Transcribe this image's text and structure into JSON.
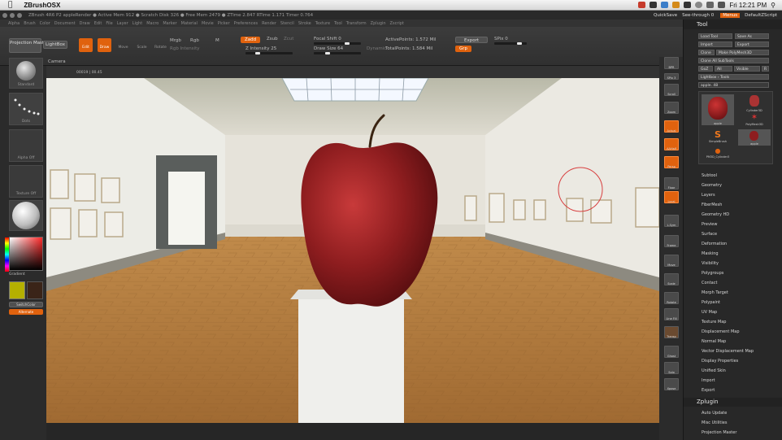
{
  "mac_menubar": {
    "app_name": "ZBrushOSX",
    "clock": "Fri 12:21 PM"
  },
  "title_bar": {
    "info": "ZBrush 4R6 P2    appleRender  ● Active Mem 912 ● Scratch Disk 326 ● Free Mem 2479 ● ZTime 2.847 RTime 1.171 Timer 0.764",
    "quicksave": "QuickSave",
    "seethrough": "See-through  0",
    "menus_label": "Menus",
    "script": "DefaultZScript"
  },
  "menu_row": [
    "Alpha",
    "Brush",
    "Color",
    "Document",
    "Draw",
    "Edit",
    "File",
    "Layer",
    "Light",
    "Macro",
    "Marker",
    "Material",
    "Movie",
    "Picker",
    "Preferences",
    "Render",
    "Stencil",
    "Stroke",
    "Texture",
    "Tool",
    "Transform",
    "Zplugin",
    "Zscript"
  ],
  "shelf": {
    "projection_master": "Projection Master",
    "lightbox": "LightBox",
    "edit": "Edit",
    "draw": "Draw",
    "move": "Move",
    "scale": "Scale",
    "rotate": "Rotate",
    "mrgb": "Mrgb",
    "rgb": "Rgb",
    "m": "M",
    "zadd": "Zadd",
    "zsub": "Zsub",
    "zcut": "Zcut",
    "rgb_intensity": "Rgb Intensity",
    "z_intensity": "Z Intensity 25",
    "focal_shift": "Focal Shift 0",
    "draw_size": "Draw Size 64",
    "dynamic": "Dynamic",
    "active_points": "ActivePoints: 1.572 Mil",
    "total_points": "TotalPoints: 1.584 Mil",
    "export": "Export",
    "spix": "SPix 0",
    "grp": "Grp"
  },
  "camera": {
    "label": "Camera",
    "value": "00019 | 00.45"
  },
  "left_tray": {
    "standard": "Standard",
    "dots": "Dots",
    "alpha_off": "Alpha Off",
    "texture_off": "Texture Off",
    "material": "SkinShade4",
    "gradient": "Gradient",
    "switch_color": "SwitchColor",
    "alternate": "Alternate",
    "colors": {
      "primary": "#b5b000",
      "secondary": "#3a2418"
    }
  },
  "right_tray": [
    "BPR",
    "SPix 3",
    "Scroll",
    "Zoom",
    "Actual",
    "AAHalf",
    "Persp",
    "Floor",
    "Local",
    "L.Sym",
    "Frame",
    "Move",
    "Scale",
    "Rotate",
    "Line Fill",
    "Transp",
    "Ghost",
    "Solo",
    "Xpose"
  ],
  "tool_panel": {
    "title": "Tool",
    "buttons": [
      "Load Tool",
      "Save As",
      "Import",
      "Export",
      "Clone",
      "Make PolyMesh3D",
      "Clone All SubTools",
      "GoZ",
      "All",
      "Visible",
      "R",
      "Lightbox › Tools"
    ],
    "current": "apple. 48",
    "thumbs": [
      "apple",
      "Cylinder3D",
      "PolyMesh3D",
      "SimpleBrush",
      "apple",
      "PM3D_Cylinder3"
    ],
    "sections": [
      "Subtool",
      "Geometry",
      "Layers",
      "FiberMesh",
      "Geometry HD",
      "Preview",
      "Surface",
      "Deformation",
      "Masking",
      "Visibility",
      "Polygroups",
      "Contact",
      "Morph Target",
      "Polypaint",
      "UV Map",
      "Texture Map",
      "Displacement Map",
      "Normal Map",
      "Vector Displacement Map",
      "Display Properties",
      "Unified Skin",
      "Import",
      "Export"
    ],
    "zplugin_title": "Zplugin",
    "zplugin_items": [
      "Auto Update",
      "Misc Utilities",
      "Projection Master"
    ]
  }
}
